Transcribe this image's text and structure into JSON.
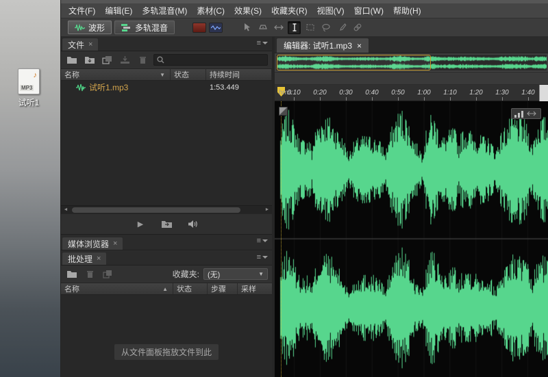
{
  "ui": {
    "close_glyph": "×",
    "dropdown_glyph": "▼",
    "sort_desc_glyph": "▼",
    "sort_asc_glyph": "▲",
    "scroll_left_glyph": "◄",
    "scroll_right_glyph": "►",
    "play_glyph": "▶",
    "panel_menu_glyph": "≡",
    "note_glyph": "♪"
  },
  "desktop": {
    "icon_label": "试听1",
    "icon_badge": "MP3"
  },
  "menubar": {
    "items": [
      "文件(F)",
      "编辑(E)",
      "多轨混音(M)",
      "素材(C)",
      "效果(S)",
      "收藏夹(R)",
      "视图(V)",
      "窗口(W)",
      "帮助(H)"
    ]
  },
  "toolbar": {
    "waveform_label": "波形",
    "multitrack_label": "多轨混音"
  },
  "files": {
    "tab": "文件",
    "search_value": "",
    "columns": [
      "名称",
      "状态",
      "持续时间"
    ],
    "rows": [
      {
        "name": "试听1.mp3",
        "status": "",
        "duration": "1:53.449"
      }
    ]
  },
  "media_browser": {
    "tab": "媒体浏览器"
  },
  "batch": {
    "tab": "批处理",
    "favorites_label": "收藏夹:",
    "favorites_value": "(无)",
    "columns": [
      "名称",
      "状态",
      "步骤",
      "采样"
    ],
    "empty_text": "从文件面板拖放文件到此"
  },
  "editor": {
    "tab": "编辑器: 试听1.mp3",
    "timeline_unit": "hms",
    "ticks": [
      "0:10",
      "0:20",
      "0:30",
      "0:40",
      "0:50",
      "1:00",
      "1:10",
      "1:20",
      "1:30",
      "1:40"
    ]
  },
  "colors": {
    "waveform_green": "#57d68d",
    "playhead_yellow": "#e8c435"
  }
}
